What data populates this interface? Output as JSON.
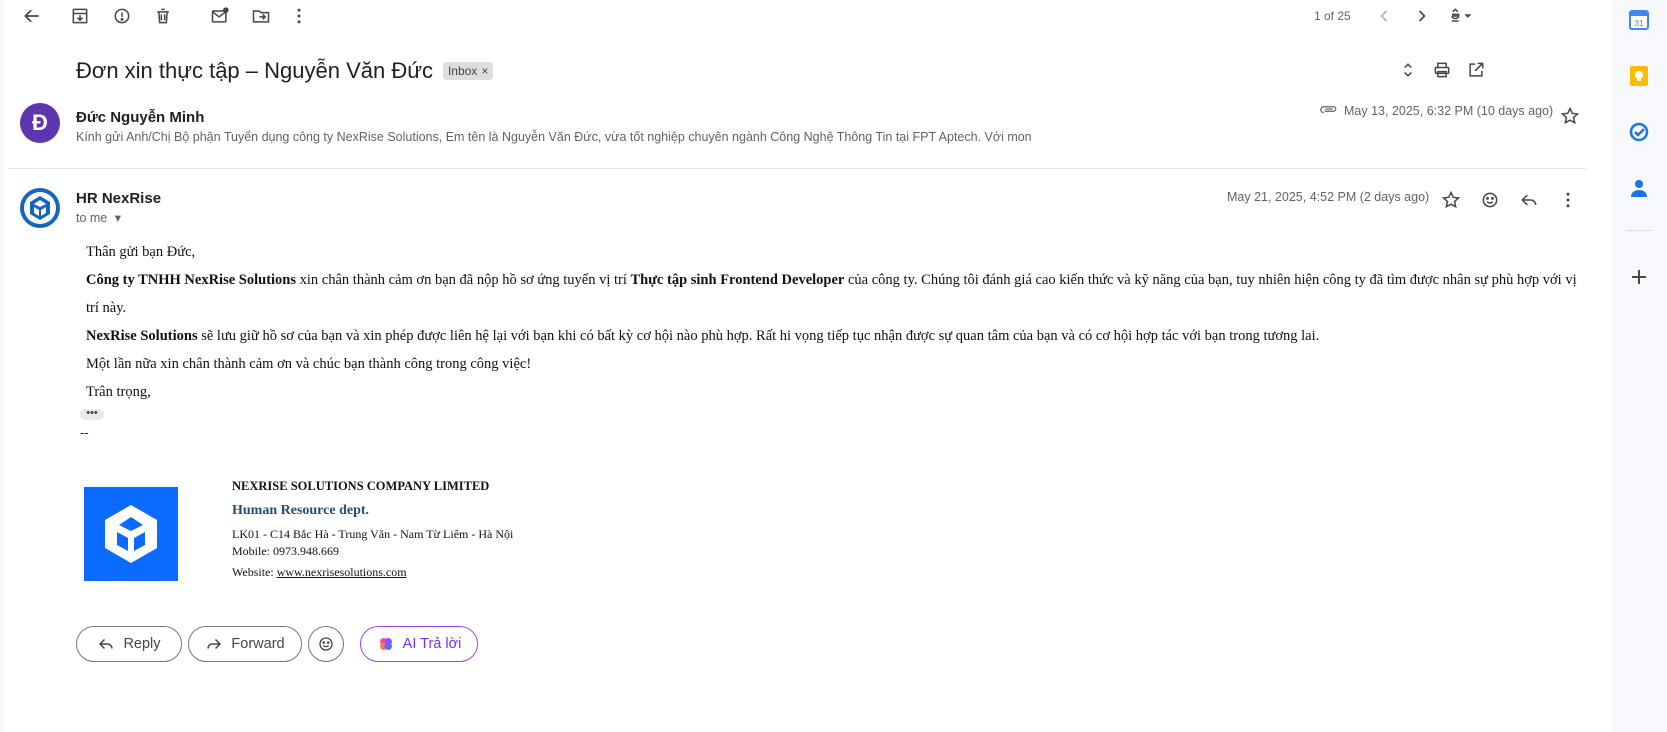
{
  "toolbar": {
    "pager": "1 of 25"
  },
  "subject": {
    "title": "Đơn xin thực tập – Nguyễn Văn Đức",
    "label_chip": "Inbox",
    "chip_close": "×"
  },
  "first_message": {
    "avatar_letter": "Đ",
    "avatar_color": "#5e35b1",
    "sender": "Đức Nguyễn Minh",
    "snippet": "Kính gửi Anh/Chị Bộ phận Tuyển dụng công ty NexRise Solutions, Em tên là Nguyễn Văn Đức, vừa tốt nghiệp chuyên ngành Công Nghệ Thông Tin tại FPT Aptech. Với mon",
    "date": "May 13, 2025, 6:32 PM (10 days ago)"
  },
  "second_message": {
    "sender": "HR NexRise",
    "to": "to me",
    "date": "May 21, 2025, 4:52 PM (2 days ago)",
    "greeting": "Thân gửi bạn Đức,",
    "p1_company": "Công ty TNHH NexRise Solutions",
    "p1_mid": " xin chân thành cảm ơn bạn đã nộp hồ sơ ứng tuyển vị trí ",
    "p1_position": "Thực tập sinh Frontend Developer",
    "p1_end": " của công ty. Chúng tôi đánh giá cao kiến thức và kỹ năng của bạn, tuy nhiên hiện công ty đã tìm được nhân sự phù hợp với vị trí này.",
    "p2_company": "NexRise Solutions",
    "p2_rest": " sẽ lưu giữ hồ sơ của bạn và xin phép được liên hệ lại với bạn khi có bất kỳ cơ hội nào phù hợp. Rất hi vọng tiếp tục nhận được sự quan tâm của bạn và có cơ hội hợp tác với bạn trong tương lai.",
    "p3": "Một lần nữa xin chân thành cảm ơn và chúc bạn thành công trong công việc!",
    "closing": "Trân trọng,",
    "dots": "•••",
    "sig_sep": "--"
  },
  "signature": {
    "company": "NEXRISE SOLUTIONS COMPANY LIMITED",
    "dept": "Human Resource dept.",
    "address": "LK01 - C14 Bắc Hà - Trung Văn - Nam Từ Liêm - Hà Nội",
    "mobile": "Mobile: 0973.948.669",
    "website_label": "Website: ",
    "website": "www.nexrisesolutions.com",
    "logo_color": "#0b6bff"
  },
  "actions": {
    "reply": "Reply",
    "forward": "Forward",
    "ai_reply": "AI Trả lời"
  },
  "colors": {
    "dept": "#1f4e79",
    "ai_border": "#a142f4",
    "ai_text": "#7b2ff7"
  }
}
